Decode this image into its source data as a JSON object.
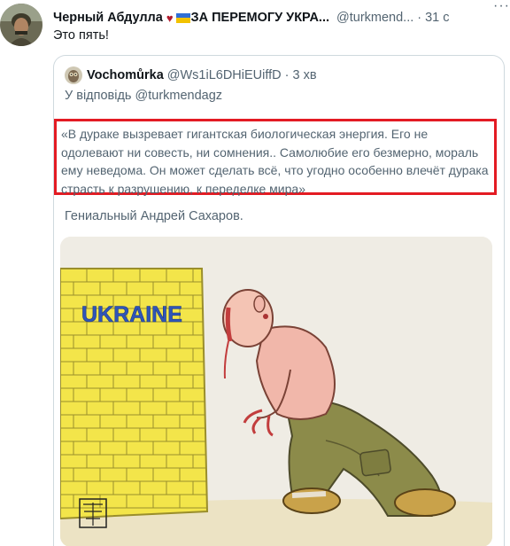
{
  "tweet": {
    "author_name": "Черный Абдулла",
    "heart": "♥",
    "author_name_2": "ЗА ПЕРЕМОГУ УКРА...",
    "handle": "@turkmend...",
    "dot": "·",
    "time": "31 с",
    "more": "···",
    "text": "Это пять!"
  },
  "quote": {
    "author_name": "Vochomůrka",
    "handle": "@Ws1iL6DHiEUiffD",
    "dot": "·",
    "time": "3 хв",
    "reply_prefix": "У відповідь",
    "reply_handle": "@turkmendagz",
    "highlighted_text": "«В дураке вызревает гигантская биологическая энергия. Его не одолевают ни совесть, ни сомнения.. Самолюбие его безмерно, мораль ему неведома. Он может сделать всё, что угодно особенно влечёт дурака страсть к разрушению, к переделке мира»",
    "text": "Гениальный Андрей Сахаров.",
    "image": {
      "wall_label": "UKRAINE",
      "colors": {
        "wall": "#f3e54a",
        "brick_line": "#9a8e2c",
        "label": "#2f55b8"
      }
    }
  },
  "colors": {
    "highlight_border": "#e31b23",
    "secondary_text": "#536471",
    "border": "#cfd9de",
    "heart": "#b31b2e"
  },
  "icons": [
    "heart-icon",
    "ukraine-flag-icon",
    "more-options-icon",
    "avatar",
    "quote-avatar"
  ]
}
